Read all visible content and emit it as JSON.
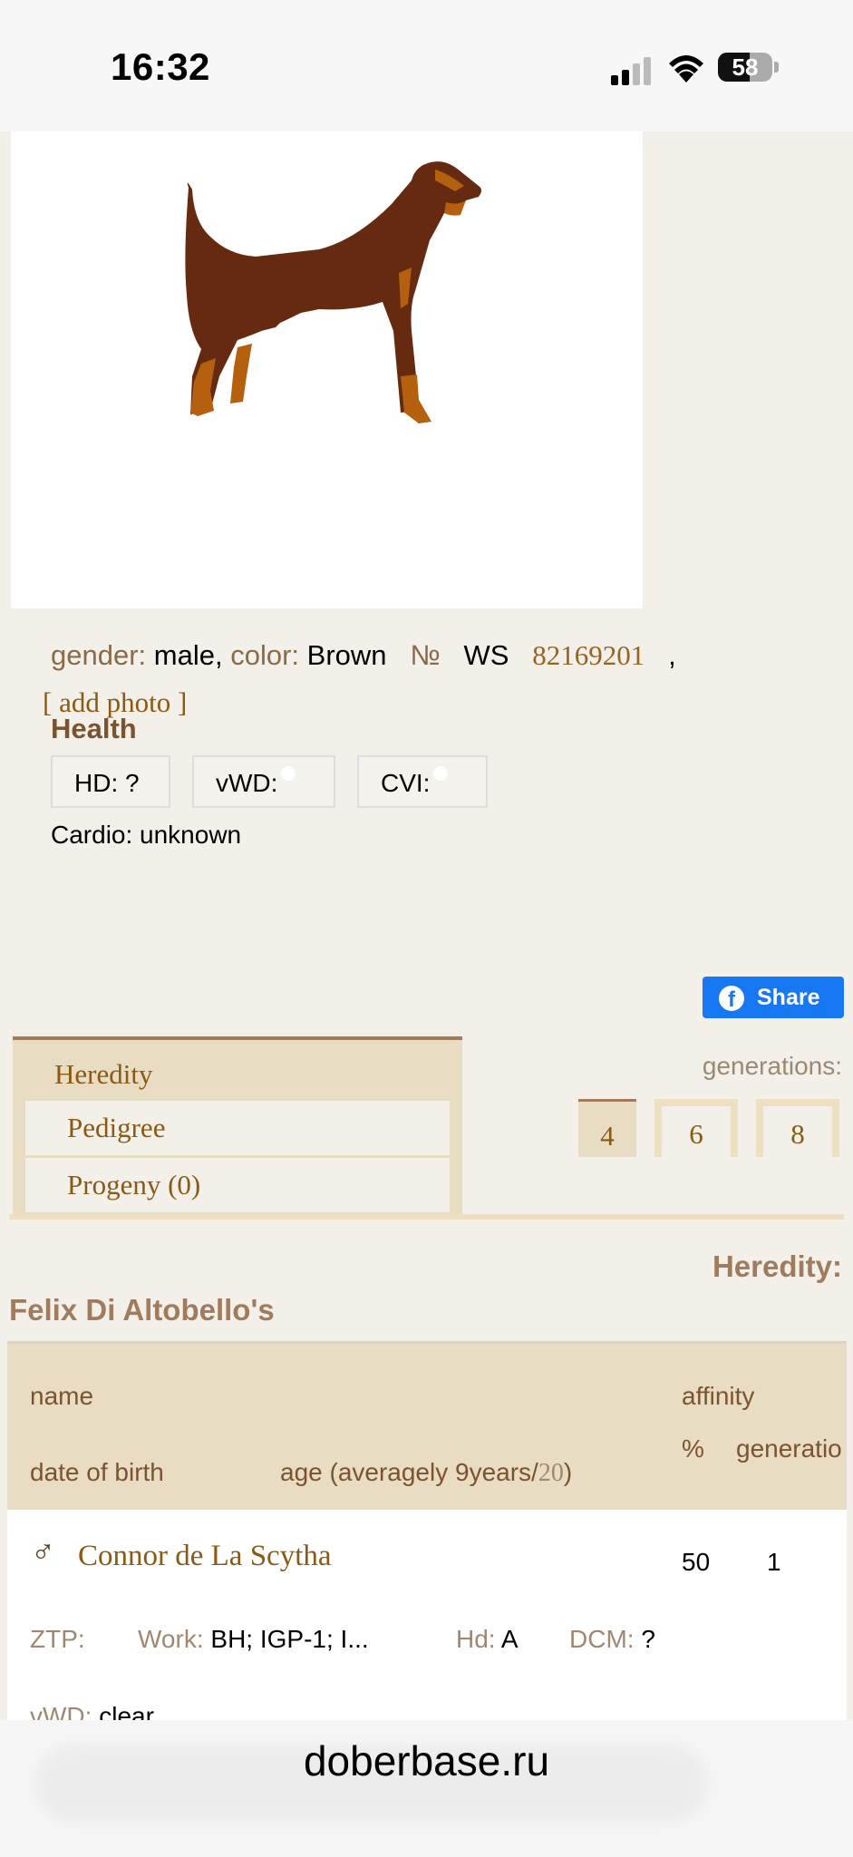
{
  "status": {
    "time": "16:32",
    "battery": "58",
    "battery_level": 0.58
  },
  "photo": {
    "add_label": "[ add photo ]"
  },
  "info": {
    "gender_label": "gender:",
    "gender_value": "male,",
    "color_label": "color:",
    "color_value": "Brown",
    "no_symbol": "№",
    "reg_prefix": "WS",
    "reg_number": "82169201",
    "trailing": ","
  },
  "health": {
    "title": "Health",
    "hd": "HD: ?",
    "vwd": "vWD:",
    "cvi": "CVI:",
    "cardio": "Cardio: unknown"
  },
  "share": {
    "label": "Share"
  },
  "tabs": {
    "heredity": "Heredity",
    "pedigree": "Pedigree",
    "progeny": "Progeny (0)",
    "generations_label": "generations:",
    "generations": [
      "4",
      "6",
      "8"
    ]
  },
  "heredity": {
    "title": "Heredity:",
    "dog_name": "Felix Di Altobello's",
    "headers": {
      "name": "name",
      "affinity": "affinity",
      "date_of_birth": "date of birth",
      "age": "age (averagely 9years/",
      "age_num": "20",
      "age_close": ")",
      "percent": "%",
      "generation": "generation"
    },
    "row": {
      "sex_symbol": "♂",
      "name": "Connor de La Scytha",
      "percent": "50",
      "generation": "1",
      "ztp_label": "ZTP:",
      "work_label": "Work:",
      "work_value": "BH; IGP-1; I...",
      "hd_label": "Hd:",
      "hd_value": "A",
      "dcm_label": "DCM:",
      "dcm_value": "?",
      "vwd_label": "vWD:",
      "vwd_value": "clear"
    }
  },
  "browser": {
    "url": "doberbase.ru"
  },
  "colors": {
    "accent": "#8a5a14",
    "tan": "#e8dcc2",
    "background": "#f2f0e9",
    "dog_body": "#652a10",
    "dog_tan": "#b5600f",
    "facebook": "#1877f2"
  }
}
